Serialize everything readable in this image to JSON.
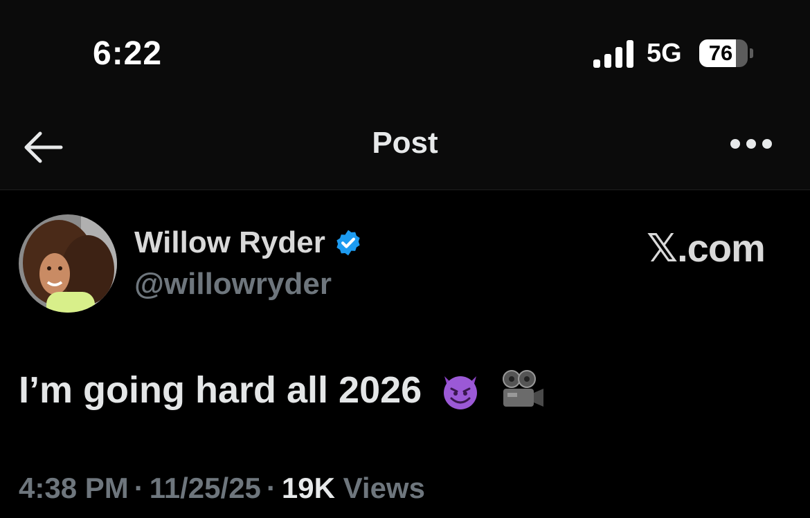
{
  "status_bar": {
    "time": "6:22",
    "network": "5G",
    "battery_percent": 76
  },
  "header": {
    "title": "Post",
    "back_icon": "arrow-left-icon",
    "more_icon": "more-horizontal-icon"
  },
  "post": {
    "author": {
      "display_name": "Willow Ryder",
      "handle": "@willowryder",
      "verified": true,
      "verified_color": "#1d9bf0"
    },
    "watermark": "𝕏.com",
    "text": "I’m going hard all 2026",
    "emojis": [
      "smiling-devil-emoji",
      "movie-camera-emoji"
    ],
    "time": "4:38 PM",
    "date": "11/25/25",
    "separator": "·",
    "views_count": "19K",
    "views_label": "Views"
  }
}
